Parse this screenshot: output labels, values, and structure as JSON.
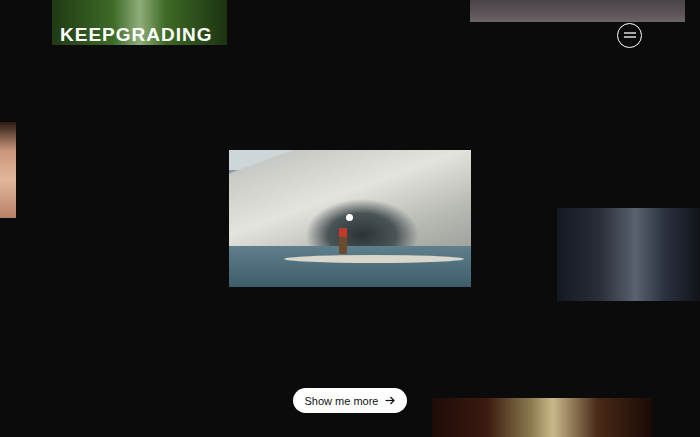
{
  "header": {
    "logo": "KEEPGRADING"
  },
  "cta": {
    "label": "Show me more"
  }
}
